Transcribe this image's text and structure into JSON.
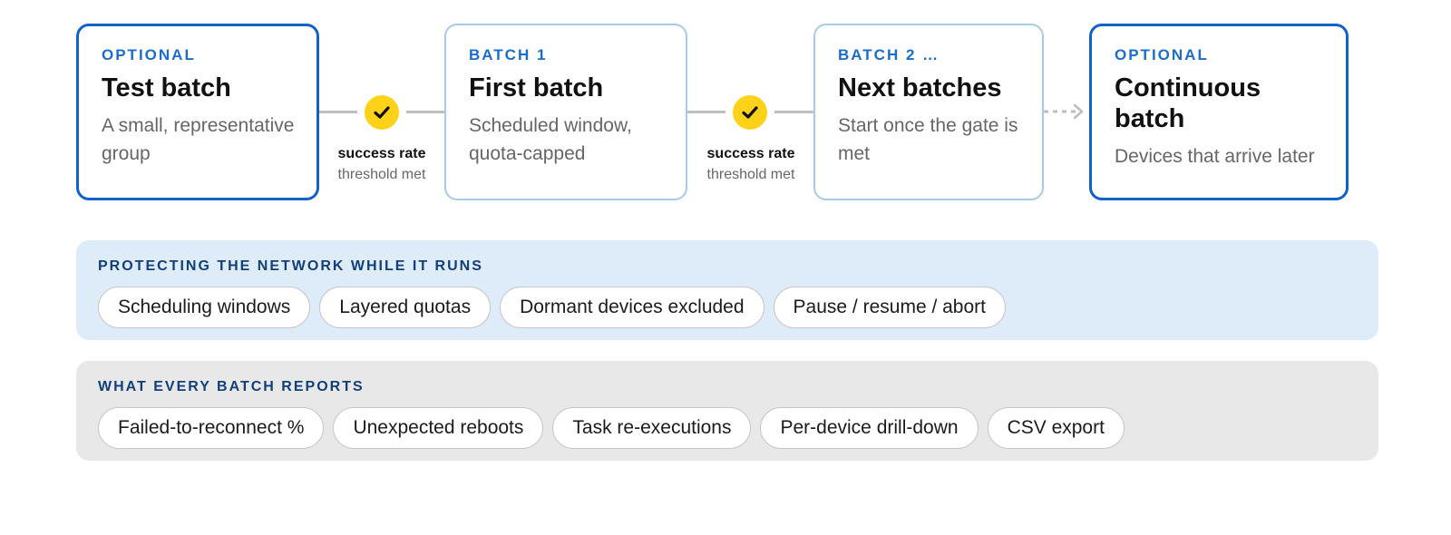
{
  "flow": {
    "stages": [
      {
        "eyebrow": "OPTIONAL",
        "title": "Test batch",
        "desc": "A small, representative group",
        "emphasis": "strong"
      },
      {
        "eyebrow": "BATCH 1",
        "title": "First batch",
        "desc": "Scheduled window, quota-capped",
        "emphasis": "light"
      },
      {
        "eyebrow": "BATCH 2 …",
        "title": "Next batches",
        "desc": "Start once the gate is met",
        "emphasis": "light"
      },
      {
        "eyebrow": "OPTIONAL",
        "title": "Continuous batch",
        "desc": "Devices that arrive later",
        "emphasis": "strong"
      }
    ],
    "gates": [
      {
        "label_strong": "success rate",
        "label_soft": "threshold met",
        "icon": "checkmark-icon"
      },
      {
        "label_strong": "success rate",
        "label_soft": "threshold met",
        "icon": "checkmark-icon"
      }
    ],
    "final_connector": "dashed-arrow"
  },
  "protection": {
    "heading": "PROTECTING THE NETWORK WHILE IT RUNS",
    "chips": [
      "Scheduling windows",
      "Layered quotas",
      "Dormant devices excluded",
      "Pause / resume / abort"
    ]
  },
  "reports": {
    "heading": "WHAT EVERY BATCH REPORTS",
    "chips": [
      "Failed-to-reconnect %",
      "Unexpected reboots",
      "Task re-executions",
      "Per-device drill-down",
      "CSV export"
    ]
  },
  "colors": {
    "accent": "#0f62c8",
    "eyebrow": "#1a6dce",
    "card_border_light": "#a9cbeb",
    "gate_check": "#ffd21a",
    "panel_blue": "#deebf8",
    "panel_gray": "#e8e8e8",
    "panel_heading": "#123f7a"
  }
}
